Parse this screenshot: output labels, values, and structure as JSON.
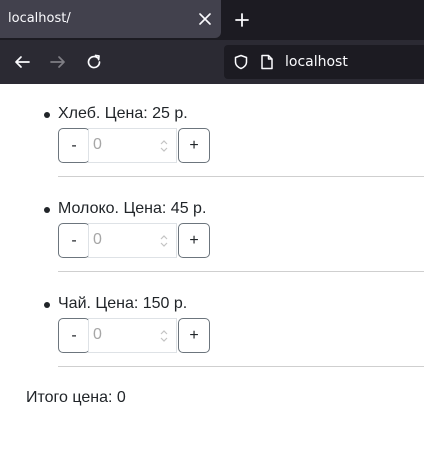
{
  "browser": {
    "tab_title": "localhost/",
    "close_icon": "close-icon",
    "new_tab_icon": "plus-icon",
    "url": "localhost",
    "icons": [
      "back-arrow-icon",
      "forward-arrow-icon",
      "reload-icon",
      "shield-icon",
      "page-icon"
    ],
    "colors": {
      "tabbar": "#1c1b22",
      "tab": "#42414d",
      "navbar": "#2b2a33"
    }
  },
  "products": [
    {
      "label": "Хлеб. Цена: 25 р.",
      "minus": "-",
      "plus": "+",
      "placeholder": "0"
    },
    {
      "label": "Молоко. Цена: 45 р.",
      "minus": "-",
      "plus": "+",
      "placeholder": "0"
    },
    {
      "label": "Чай. Цена: 150 р.",
      "minus": "-",
      "plus": "+",
      "placeholder": "0"
    }
  ],
  "total": {
    "label": "Итого цена: 0"
  }
}
